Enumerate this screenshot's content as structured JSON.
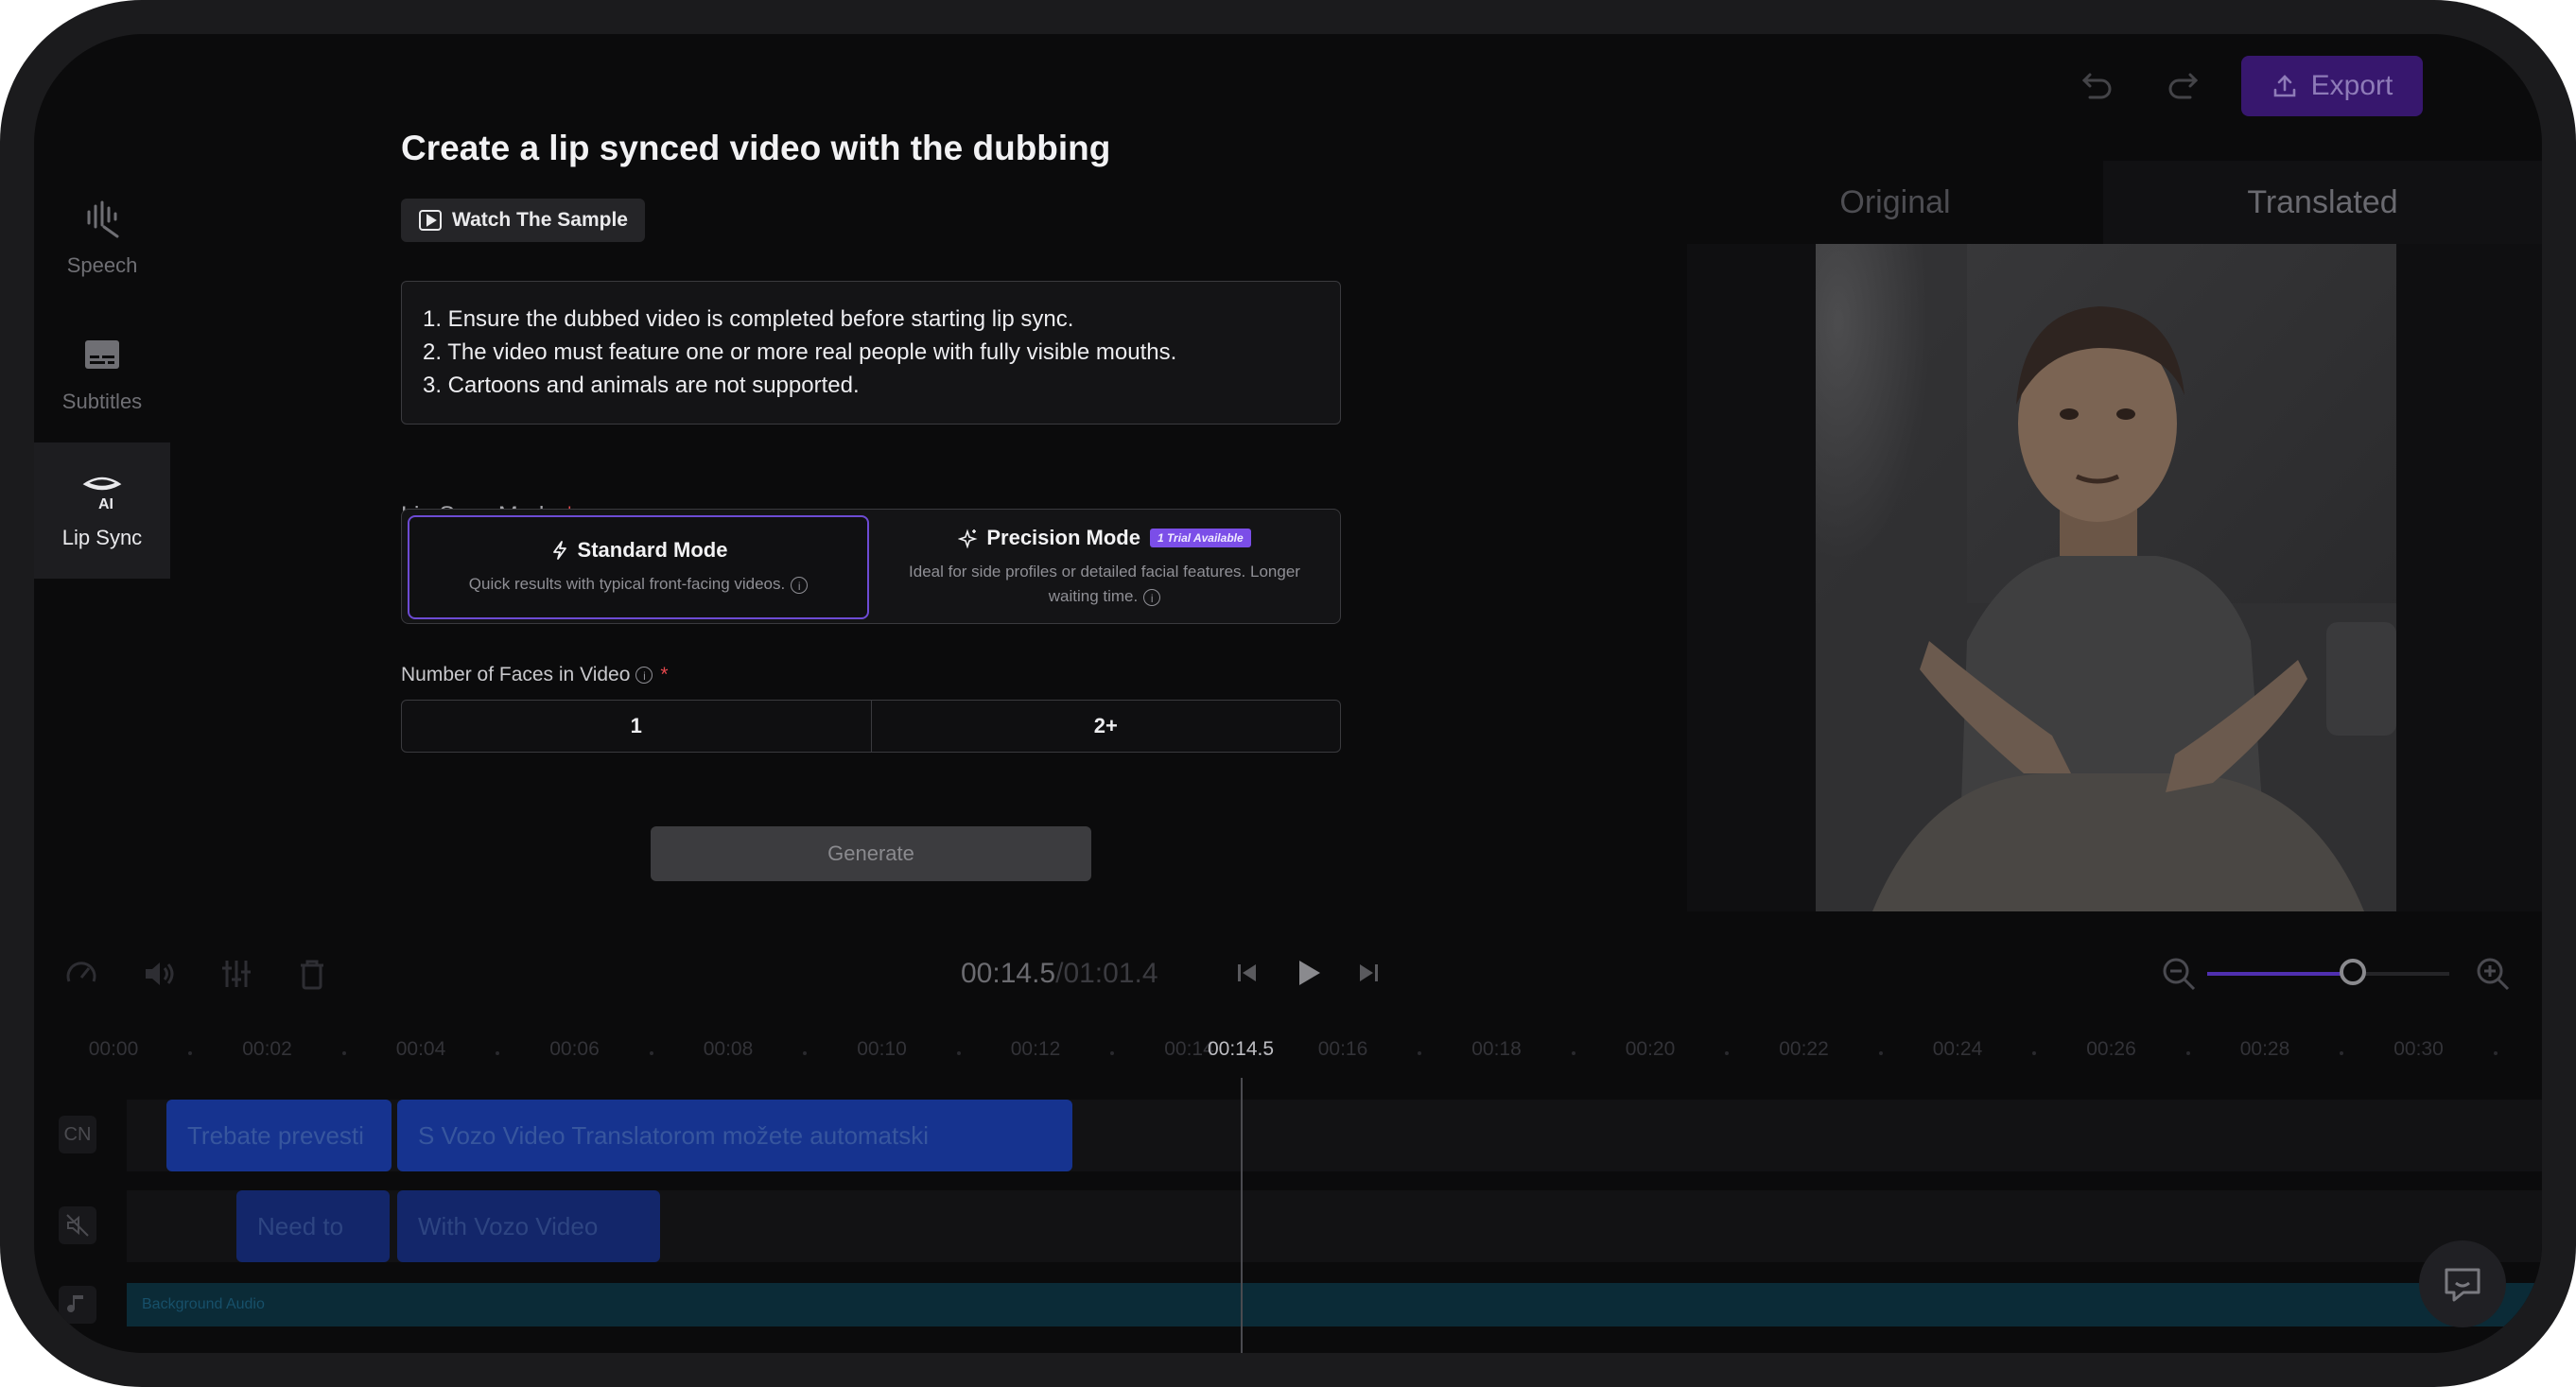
{
  "sidebar": {
    "items": [
      {
        "label": "Speech",
        "icon": "waveform-icon"
      },
      {
        "label": "Subtitles",
        "icon": "subtitles-icon"
      },
      {
        "label": "Lip Sync",
        "icon": "lip-sync-ai-icon",
        "active": true
      }
    ]
  },
  "toolbar": {
    "export_label": "Export"
  },
  "panel": {
    "title": "Create a lip synced video with the dubbing",
    "sample_label": "Watch The Sample",
    "rules": [
      "1. Ensure the dubbed video is completed before starting lip sync.",
      "2. The video must feature one or more real people with fully visible mouths.",
      "3. Cartoons and animals are not supported."
    ],
    "mode_label": "Lip Sync Mode",
    "required_mark": "*",
    "modes": {
      "standard": {
        "title": "Standard Mode",
        "desc": "Quick results with typical front-facing videos."
      },
      "precision": {
        "title": "Precision Mode",
        "badge": "1 Trial Available",
        "desc": "Ideal for side profiles or detailed facial features. Longer waiting time."
      }
    },
    "faces_label": "Number of Faces in Video",
    "faces_options": [
      "1",
      "2+"
    ],
    "generate_label": "Generate"
  },
  "preview": {
    "tabs": [
      "Original",
      "Translated"
    ],
    "active_tab": "Translated"
  },
  "player": {
    "current_time": "00:14.5",
    "separator": " / ",
    "total_time": "01:01.4",
    "zoom_level": 0.6
  },
  "timeline": {
    "ticks": [
      "00:00",
      "00:02",
      "00:04",
      "00:06",
      "00:08",
      "00:10",
      "00:12",
      "00:14",
      "00:16",
      "00:18",
      "00:20",
      "00:22",
      "00:24",
      "00:26",
      "00:28",
      "00:30"
    ],
    "playhead_label": "00:14.5",
    "tracks": {
      "cn_label": "CN",
      "cn_clips": [
        "Trebate prevesti",
        "S Vozo Video Translatorom možete automatski"
      ],
      "orig_clips": [
        "Need to",
        "With Vozo Video"
      ],
      "bg_audio_label": "Background Audio"
    }
  },
  "colors": {
    "accent": "#6d4bd4",
    "export_bg": "#37176e",
    "clip": "#16338f",
    "bg_audio": "#0b2b37"
  }
}
